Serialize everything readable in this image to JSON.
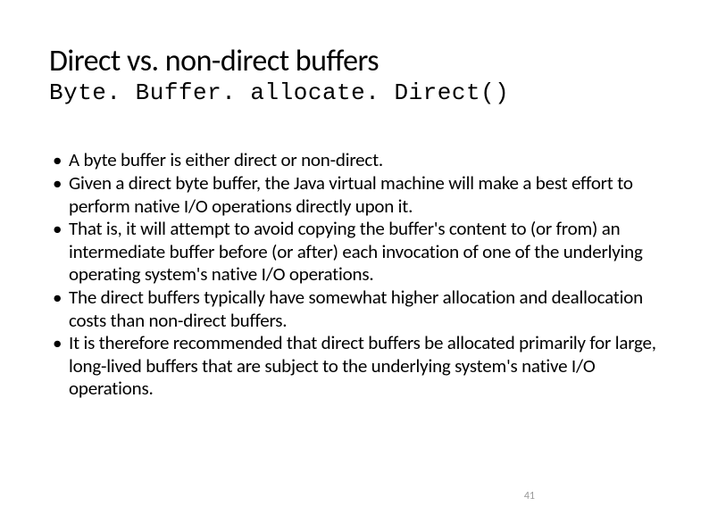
{
  "slide": {
    "title": "Direct vs. non-direct buffers",
    "subtitle": "Byte. Buffer. allocate. Direct()",
    "bullets": [
      "A byte buffer is either direct or non-direct.",
      "Given a direct byte buffer, the Java virtual machine will make a best effort to perform native I/O operations directly upon it.",
      "That is, it will attempt to avoid copying the buffer's content to (or from) an intermediate buffer before (or after) each invocation of one of the underlying operating system's native I/O operations.",
      "The direct buffers typically have somewhat higher allocation and deallocation costs than non-direct buffers.",
      "It is therefore recommended that direct buffers be allocated primarily for large, long-lived buffers that are subject to the underlying system's native I/O operations."
    ],
    "page_number": "41"
  }
}
